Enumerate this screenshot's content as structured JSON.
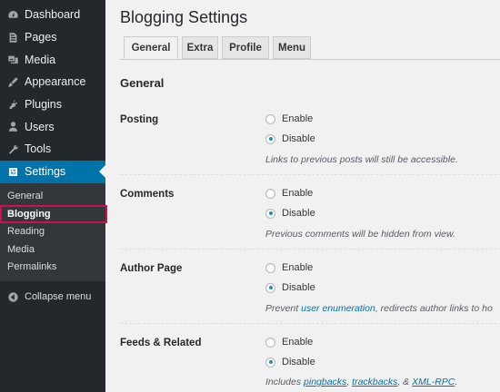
{
  "sidebar": {
    "items": [
      {
        "label": "Dashboard",
        "icon": "dashboard-icon"
      },
      {
        "label": "Pages",
        "icon": "pages-icon"
      },
      {
        "label": "Media",
        "icon": "media-icon"
      },
      {
        "label": "Appearance",
        "icon": "appearance-icon"
      },
      {
        "label": "Plugins",
        "icon": "plugins-icon"
      },
      {
        "label": "Users",
        "icon": "users-icon"
      },
      {
        "label": "Tools",
        "icon": "tools-icon"
      },
      {
        "label": "Settings",
        "icon": "settings-icon",
        "active": true
      }
    ],
    "submenu": [
      "General",
      "Blogging",
      "Reading",
      "Media",
      "Permalinks"
    ],
    "submenu_current": "Blogging",
    "collapse_label": "Collapse menu"
  },
  "page": {
    "title": "Blogging Settings",
    "tabs": [
      "General",
      "Extra",
      "Profile",
      "Menu"
    ],
    "active_tab": "General",
    "section_title": "General"
  },
  "settings": [
    {
      "label": "Posting",
      "options": [
        "Enable",
        "Disable"
      ],
      "selected": "Disable",
      "description": "Links to previous posts will still be accessible."
    },
    {
      "label": "Comments",
      "options": [
        "Enable",
        "Disable"
      ],
      "selected": "Disable",
      "description": "Previous comments will be hidden from view."
    },
    {
      "label": "Author Page",
      "options": [
        "Enable",
        "Disable"
      ],
      "selected": "Disable",
      "description_parts": {
        "before": "Prevent ",
        "link": "user enumeration",
        "after": ", redirects author links to ho"
      }
    },
    {
      "label": "Feeds & Related",
      "options": [
        "Enable",
        "Disable"
      ],
      "selected": "Disable",
      "description_parts": {
        "before": "Includes ",
        "link1": "pingbacks",
        "sep1": ", ",
        "link2": "trackbacks",
        "sep2": ", & ",
        "link3": "XML-RPC",
        "after": "."
      }
    }
  ],
  "colors": {
    "sidebar_bg": "#23282d",
    "active_bg": "#0073aa",
    "highlight_outline": "#d1104d",
    "link": "#0073aa"
  }
}
